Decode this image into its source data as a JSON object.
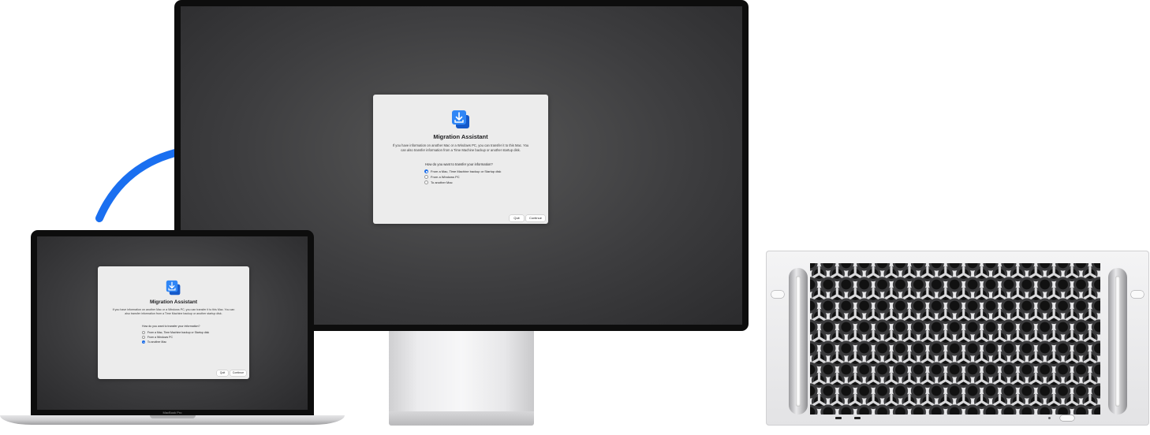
{
  "dialog": {
    "title": "Migration Assistant",
    "description": "If you have information on another Mac or a Windows PC, you can transfer it to this Mac. You can also transfer information from a Time Machine backup or another startup disk.",
    "question": "How do you want to transfer your information?",
    "options": [
      "From a Mac, Time Machine backup or Startup disk",
      "From a Windows PC",
      "To another Mac"
    ],
    "quit_label": "Quit",
    "continue_label": "Continue"
  },
  "monitor_dialog": {
    "selected_option": 0
  },
  "laptop_dialog": {
    "selected_option": 2
  },
  "laptop": {
    "label": "MacBook Pro"
  },
  "colors": {
    "arrow": "#1a6ff0",
    "accent": "#1f6fe8"
  },
  "icons": [
    "migration-assistant-icon",
    "transfer-arrow-icon"
  ]
}
